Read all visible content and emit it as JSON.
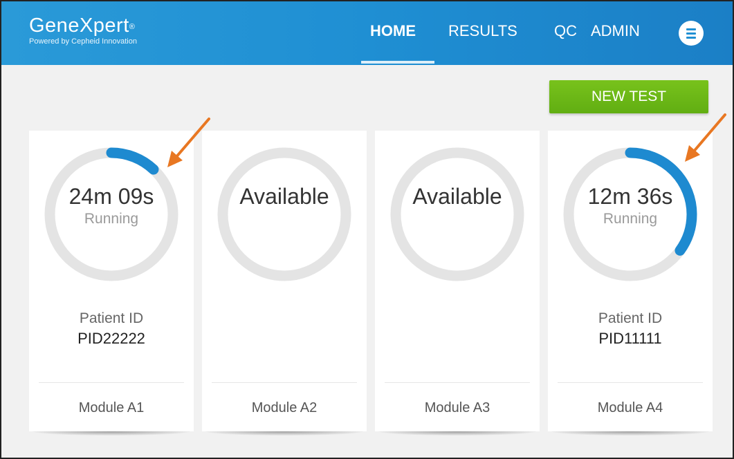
{
  "app": {
    "brand_name": "GeneXpert",
    "brand_mark": "®",
    "brand_tagline": "Powered by Cepheid Innovation"
  },
  "nav": {
    "items": [
      {
        "label": "HOME",
        "active": true
      },
      {
        "label": "RESULTS",
        "active": false
      },
      {
        "label": "QC",
        "active": false
      },
      {
        "label": "ADMIN",
        "active": false
      }
    ],
    "menu_icon": "hamburger-menu-icon"
  },
  "actions": {
    "new_test_label": "NEW TEST"
  },
  "modules": [
    {
      "name": "Module A1",
      "primary": "24m 09s",
      "status": "Running",
      "progress": 0.12,
      "patient_label": "Patient ID",
      "patient_id": "PID22222"
    },
    {
      "name": "Module A2",
      "primary": "Available",
      "status": "",
      "progress": 0,
      "patient_label": "",
      "patient_id": ""
    },
    {
      "name": "Module A3",
      "primary": "Available",
      "status": "",
      "progress": 0,
      "patient_label": "",
      "patient_id": ""
    },
    {
      "name": "Module A4",
      "primary": "12m 36s",
      "status": "Running",
      "progress": 0.35,
      "patient_label": "Patient ID",
      "patient_id": "PID11111"
    }
  ],
  "colors": {
    "header_blue": "#1f8fd3",
    "ring_track": "#e4e4e4",
    "ring_progress": "#1e8ad0",
    "new_test_green": "#6bb818",
    "annotation_arrow": "#e87722"
  }
}
